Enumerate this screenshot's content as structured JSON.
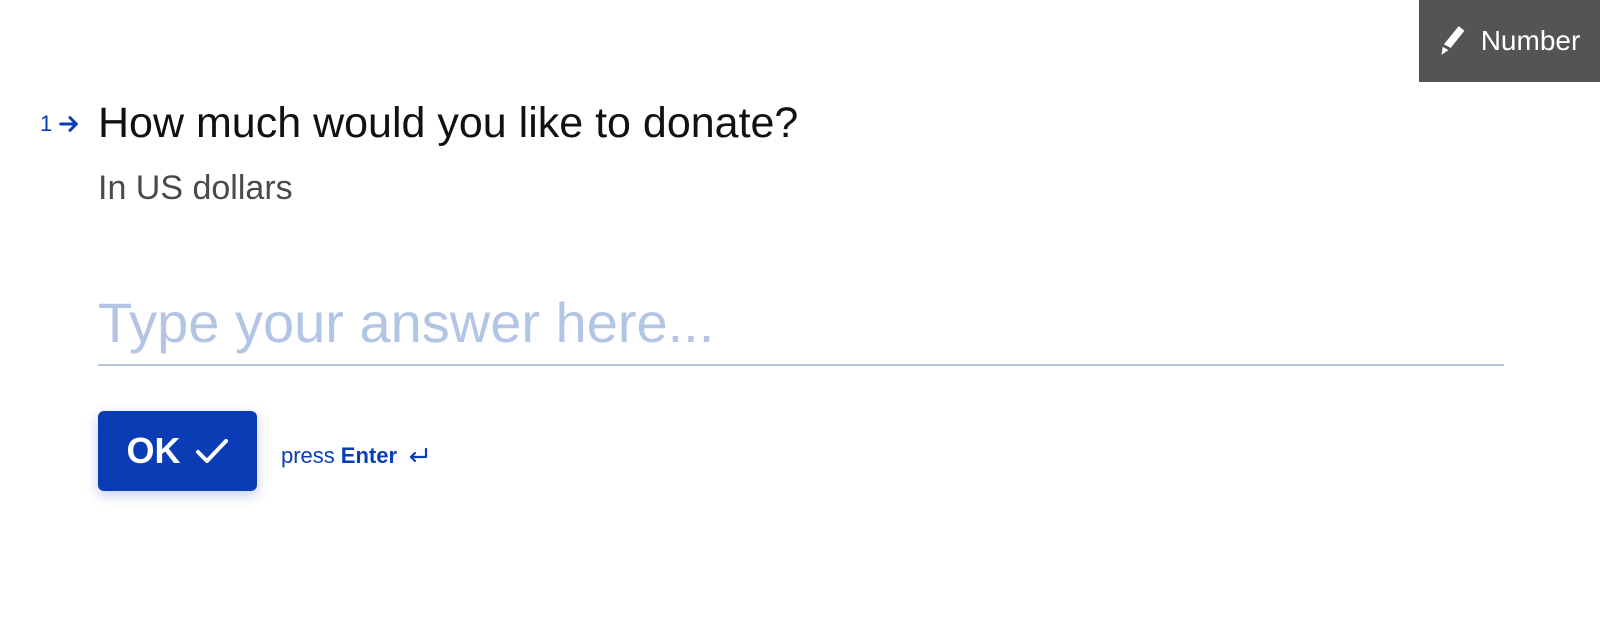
{
  "type_badge": {
    "label": "Number",
    "icon": "pencil-icon"
  },
  "question": {
    "number": "1",
    "title": "How much would you like to donate?",
    "description": "In US dollars"
  },
  "answer": {
    "placeholder": "Type your answer here...",
    "value": ""
  },
  "submit": {
    "label": "OK",
    "icon": "checkmark-icon"
  },
  "hint": {
    "prefix": "press",
    "key": "Enter",
    "icon": "enter-return-icon"
  },
  "colors": {
    "accent": "#0a3db5",
    "badge_bg": "#545454",
    "placeholder": "#b3c5e4",
    "underline": "#b9c6d8"
  }
}
